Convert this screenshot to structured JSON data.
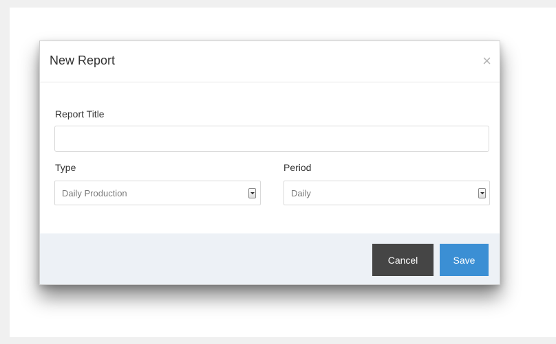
{
  "modal": {
    "title": "New Report",
    "close_icon": "close-icon",
    "fields": {
      "report_title": {
        "label": "Report Title",
        "value": "",
        "placeholder": ""
      },
      "type": {
        "label": "Type",
        "selected": "Daily Production"
      },
      "period": {
        "label": "Period",
        "selected": "Daily"
      }
    },
    "buttons": {
      "cancel_label": "Cancel",
      "save_label": "Save"
    }
  },
  "colors": {
    "cancel_button": "#454545",
    "save_button": "#3b8fd4",
    "footer_background": "#edf1f6"
  }
}
